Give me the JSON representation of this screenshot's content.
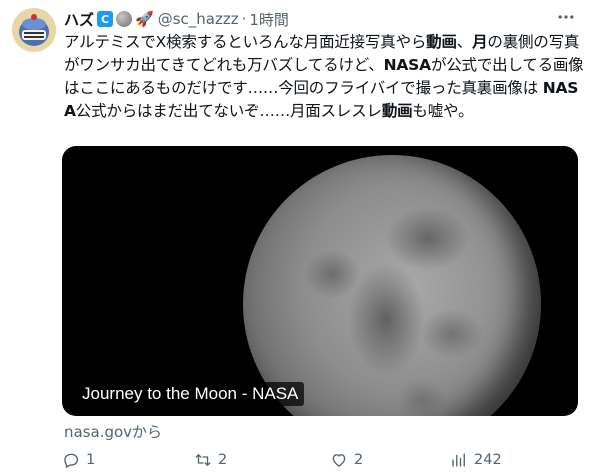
{
  "tweet": {
    "display_name": "ハズ",
    "badge_letter": "C",
    "rocket": "🚀",
    "handle": "@sc_hazzz",
    "separator": "·",
    "time": "1時間",
    "text_parts": [
      "アルテミスでX検索するといろんな月面近接写真やら",
      "動画",
      "、",
      "月",
      "の裏側の写真がワンサカ出てきてどれも万バズしてるけど、",
      "NASA",
      "が公式で出してる画像はここにあるものだけです……今回のフライバイで撮った真裏画像は ",
      "NASA",
      "公式からはまだ出てないぞ……月面スレスレ",
      "動画",
      "も嘘や。"
    ]
  },
  "card": {
    "caption": "Journey to the Moon - NASA",
    "source": "nasa.govから"
  },
  "actions": {
    "reply_count": "1",
    "retweet_count": "2",
    "like_count": "2",
    "view_count": "242"
  },
  "icons": {
    "avatar": "avatar-icon",
    "more": "more-icon",
    "reply": "reply-icon",
    "retweet": "retweet-icon",
    "like": "heart-icon",
    "views": "views-icon"
  },
  "colors": {
    "accent": "#1d9bf0",
    "muted": "#536471",
    "text": "#0f1419"
  }
}
